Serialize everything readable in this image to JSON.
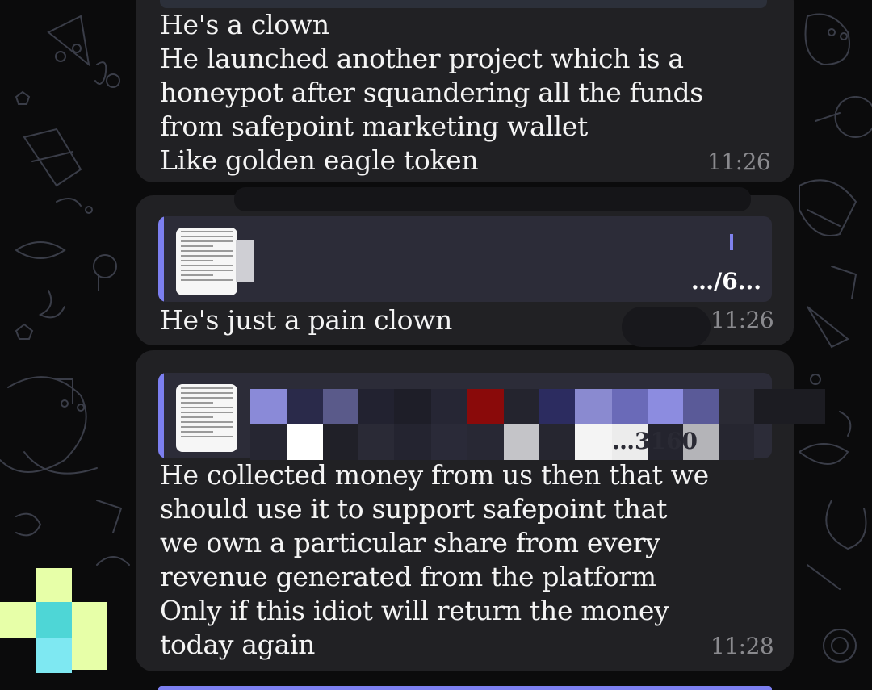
{
  "messages": [
    {
      "text": "He's a clown\nHe launched another project which is a\nhoneypot after squandering all the funds\nfrom safepoint marketing wallet\nLike golden eagle token",
      "time": "11:26"
    },
    {
      "reply_snippet": "…/6...",
      "text": "He's just a pain clown",
      "time": "11:26"
    },
    {
      "reply_snippet": "…3160",
      "text": "He collected money from us then that we\nshould use it to support safepoint that\nwe own a particular share from every\nrevenue generated from the platform\nOnly if this idiot will return the money\ntoday again",
      "time": "11:28"
    }
  ],
  "colors": {
    "background": "#0b0b0c",
    "bubble": "#212124",
    "reply_bar": "#7c7ff0",
    "timestamp": "#8a8a8e"
  }
}
